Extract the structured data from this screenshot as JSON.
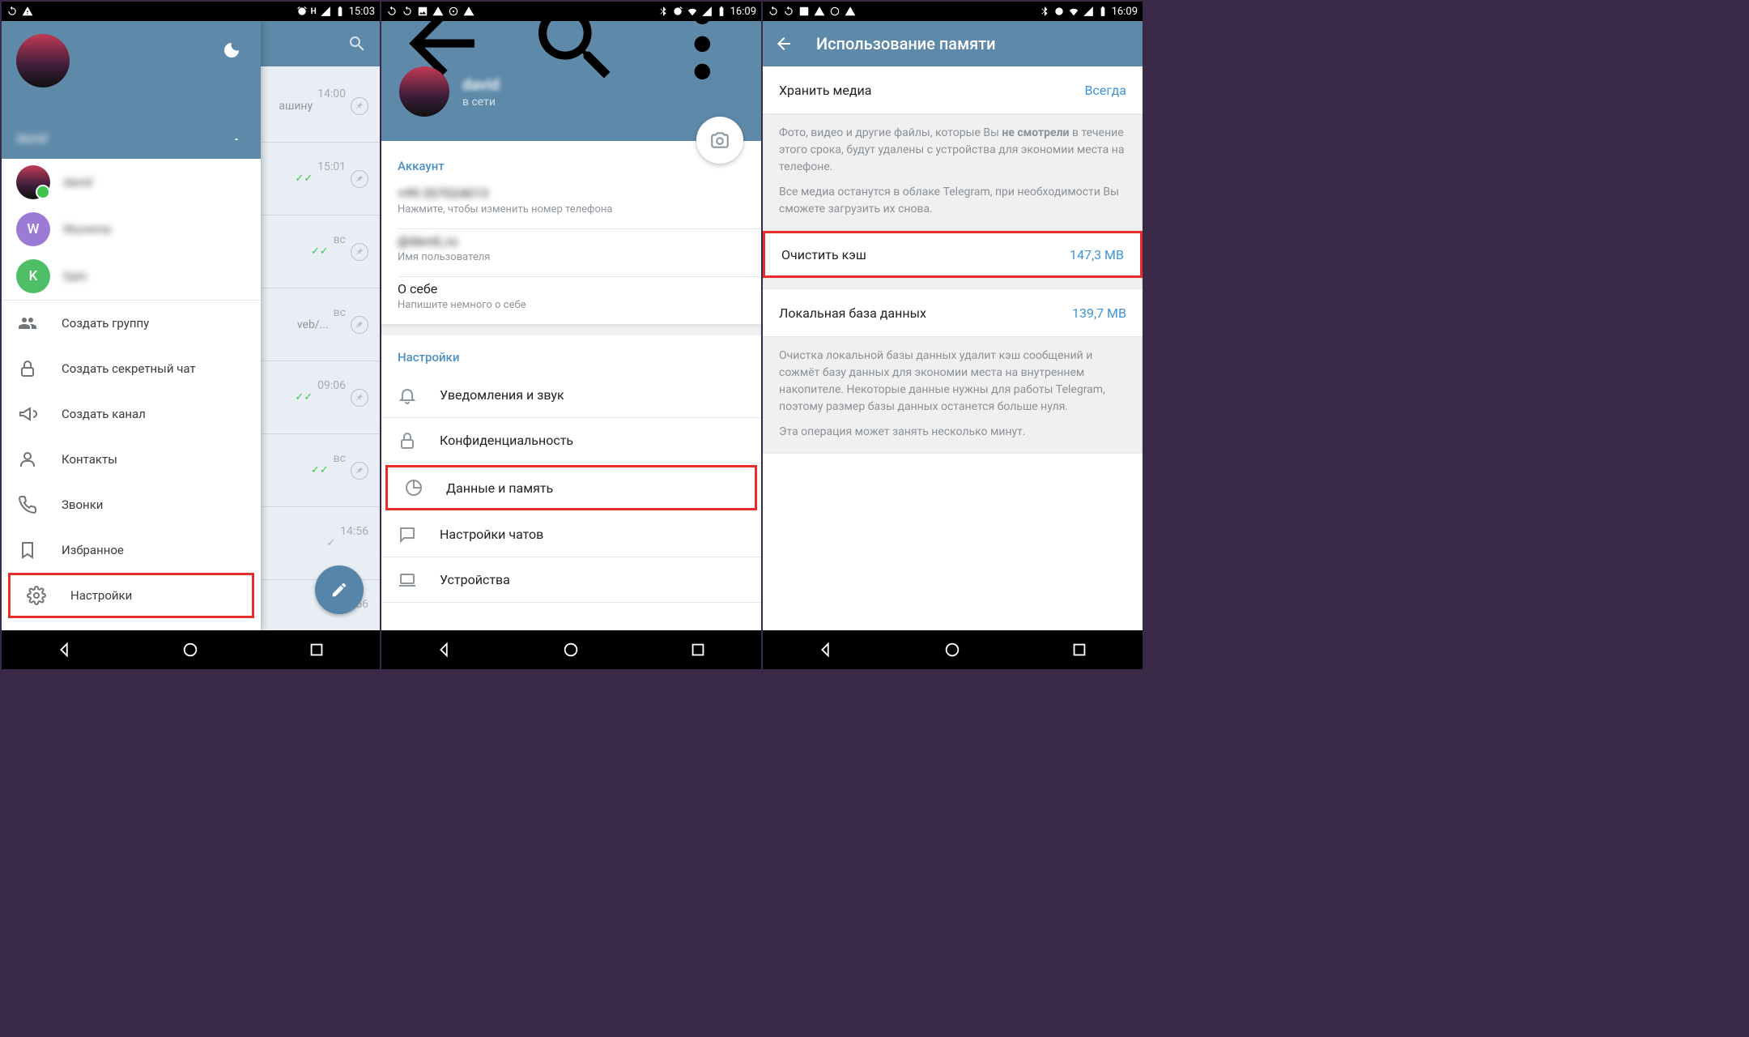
{
  "phone1": {
    "status_time": "15:03",
    "drawer": {
      "username_blurred": "david",
      "accounts": [
        {
          "letter": "",
          "name": "david"
        },
        {
          "letter": "W",
          "name": "Wurwme"
        },
        {
          "letter": "K",
          "name": "Sain"
        }
      ],
      "items": [
        {
          "label": "Создать группу"
        },
        {
          "label": "Создать секретный чат"
        },
        {
          "label": "Создать канал"
        },
        {
          "label": "Контакты"
        },
        {
          "label": "Звонки"
        },
        {
          "label": "Избранное"
        },
        {
          "label": "Настройки"
        }
      ]
    },
    "bg_rows": [
      {
        "time": "14:00",
        "sub": "ашину"
      },
      {
        "time": "15:01",
        "checks": true
      },
      {
        "time": "вс",
        "checks": true
      },
      {
        "time": "вс",
        "sub": "veb/..."
      },
      {
        "time": "09:06",
        "checks": true
      },
      {
        "time": "вс",
        "checks": true
      },
      {
        "time": "14:56",
        "checks": false
      },
      {
        "time": "14:56"
      }
    ]
  },
  "phone2": {
    "status_time": "16:09",
    "username_blurred": "david",
    "online": "в сети",
    "section_account": "Аккаунт",
    "phone_blurred": "+99 207024013",
    "phone_hint": "Нажмите, чтобы изменить номер телефона",
    "user_blurred": "@david_ru",
    "user_hint": "Имя пользователя",
    "about_label": "О себе",
    "about_hint": "Напишите немного о себе",
    "section_settings": "Настройки",
    "rows": [
      {
        "label": "Уведомления и звук"
      },
      {
        "label": "Конфиденциальность"
      },
      {
        "label": "Данные и память"
      },
      {
        "label": "Настройки чатов"
      },
      {
        "label": "Устройства"
      }
    ]
  },
  "phone3": {
    "status_time": "16:09",
    "title": "Использование памяти",
    "keep_media_label": "Хранить медиа",
    "keep_media_value": "Всегда",
    "desc1a": "Фото, видео и другие файлы, которые Вы ",
    "desc1b": "не смотрели",
    "desc1c": " в течение этого срока, будут удалены с устройства для экономии места на телефоне.",
    "desc1p2": "Все медиа останутся в облаке Telegram, при необходимости Вы сможете загрузить их снова.",
    "clear_cache_label": "Очистить кэш",
    "clear_cache_value": "147,3 MB",
    "localdb_label": "Локальная база данных",
    "localdb_value": "139,7 MB",
    "desc2": "Очистка локальной базы данных удалит кэш сообщений и сожмёт базу данных для экономии места на внутреннем накопителе. Некоторые данные нужны для работы Telegram, поэтому размер базы данных останется больше нуля.",
    "desc2p2": "Эта операция может занять несколько минут."
  }
}
